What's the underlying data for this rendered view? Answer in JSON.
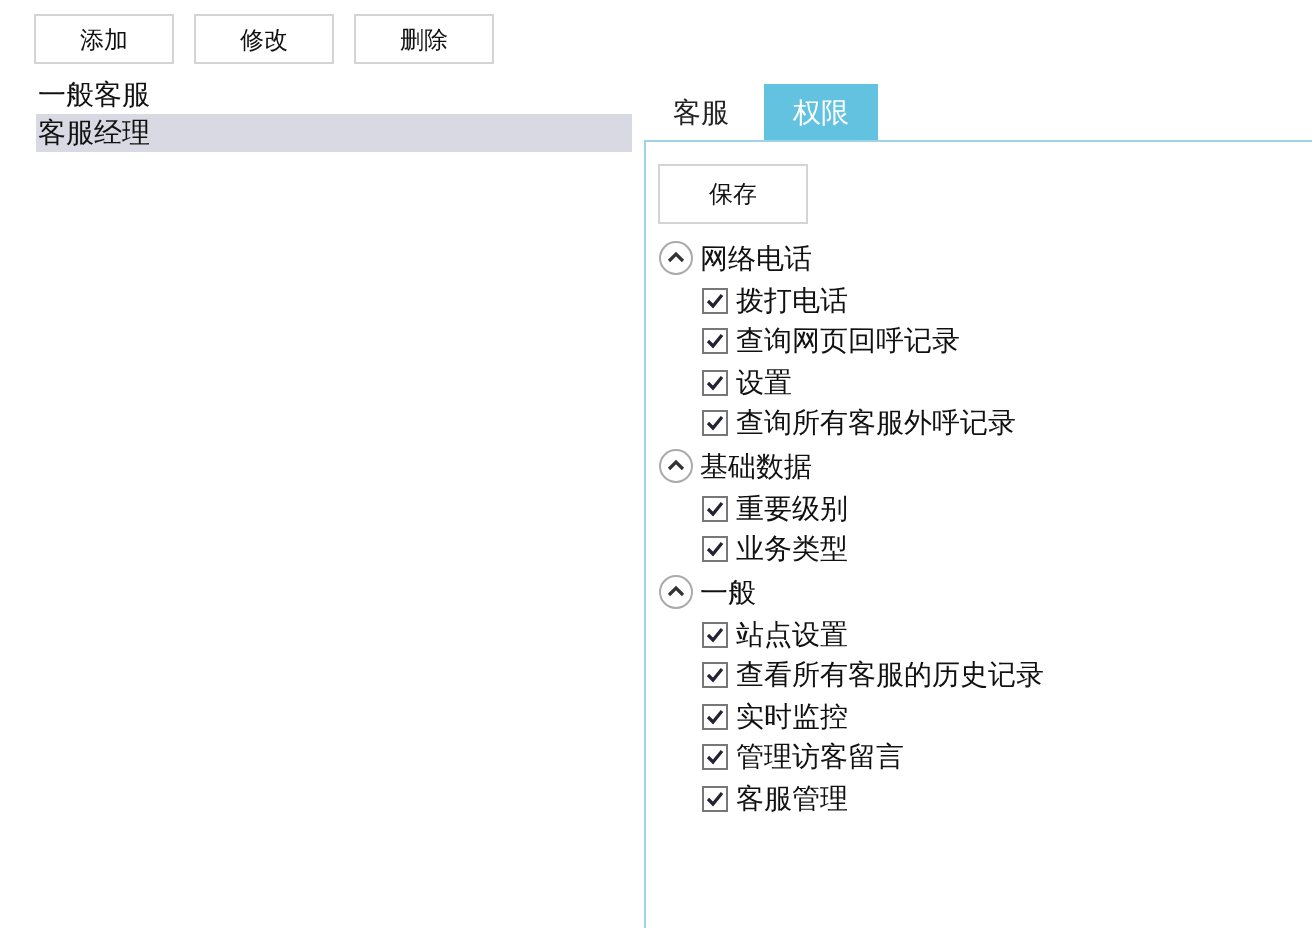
{
  "toolbar": {
    "buttons": [
      "添加",
      "修改",
      "删除"
    ]
  },
  "roles": [
    {
      "label": "一般客服",
      "selected": false
    },
    {
      "label": "客服经理",
      "selected": true
    }
  ],
  "tabs": [
    {
      "label": "客服",
      "selected": false
    },
    {
      "label": "权限",
      "selected": true
    }
  ],
  "save_button": "保存",
  "groups": [
    {
      "label": "网络电话",
      "expanded": true,
      "children": [
        {
          "label": "拨打电话",
          "checked": true
        },
        {
          "label": "查询网页回呼记录",
          "checked": true
        },
        {
          "label": "设置",
          "checked": true
        },
        {
          "label": "查询所有客服外呼记录",
          "checked": true
        }
      ]
    },
    {
      "label": "基础数据",
      "expanded": true,
      "children": [
        {
          "label": "重要级别",
          "checked": true
        },
        {
          "label": "业务类型",
          "checked": true
        }
      ]
    },
    {
      "label": "一般",
      "expanded": true,
      "children": [
        {
          "label": "站点设置",
          "checked": true
        },
        {
          "label": "查看所有客服的历史记录",
          "checked": true
        },
        {
          "label": "实时监控",
          "checked": true
        },
        {
          "label": "管理访客留言",
          "checked": true
        },
        {
          "label": "客服管理",
          "checked": true
        }
      ]
    }
  ]
}
